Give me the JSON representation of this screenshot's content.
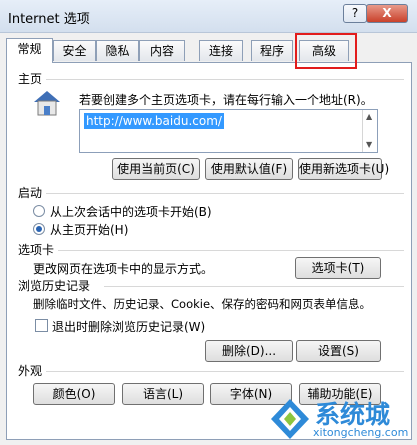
{
  "window": {
    "title": "Internet 选项",
    "help_label": "?",
    "close_label": "X"
  },
  "tabs": [
    {
      "label": "常规"
    },
    {
      "label": "安全"
    },
    {
      "label": "隐私"
    },
    {
      "label": "内容"
    },
    {
      "label": "连接"
    },
    {
      "label": "程序"
    },
    {
      "label": "高级"
    }
  ],
  "home": {
    "heading": "主页",
    "desc": "若要创建多个主页选项卡，请在每行输入一个地址(R)。",
    "url": "http://www.baidu.com/",
    "buttons": [
      "使用当前页(C)",
      "使用默认值(F)",
      "使用新选项卡(U)"
    ]
  },
  "startup": {
    "heading": "启动",
    "option_last": "从上次会话中的选项卡开始(B)",
    "option_home": "从主页开始(H)",
    "selected": "option_home"
  },
  "tabs_section": {
    "heading": "选项卡",
    "desc": "更改网页在选项卡中的显示方式。",
    "button": "选项卡(T)"
  },
  "history": {
    "heading": "浏览历史记录",
    "desc": "删除临时文件、历史记录、Cookie、保存的密码和网页表单信息。",
    "checkbox_label": "退出时删除浏览历史记录(W)",
    "checked": false,
    "delete_button": "删除(D)...",
    "settings_button": "设置(S)"
  },
  "appearance": {
    "heading": "外观",
    "buttons": [
      "颜色(O)",
      "语言(L)",
      "字体(N)",
      "辅助功能(E)"
    ]
  },
  "watermark": {
    "text": "系统城",
    "url": "xitongcheng.com"
  },
  "colors": {
    "highlight_border": "#e21c1c",
    "selection": "#3399ff",
    "watermark": "#2e8ad8"
  }
}
